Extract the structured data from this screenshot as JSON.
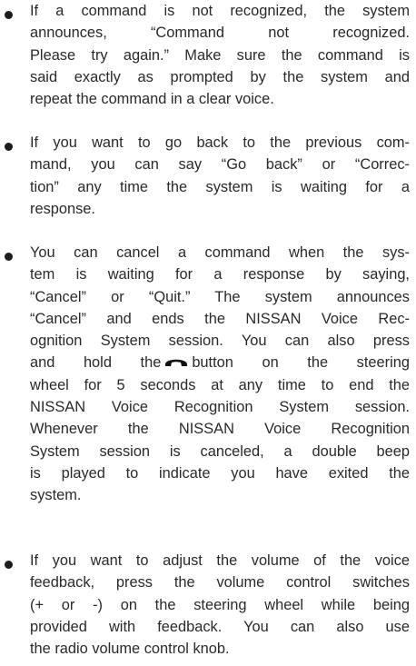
{
  "items": [
    {
      "lines": [
        "If a command is not recognized, the system",
        "announces, “Command not recognized.",
        "Please try again.” Make sure the command is",
        "said exactly as prompted by the system and",
        "repeat the command in a clear voice."
      ]
    },
    {
      "lines": [
        "If you want to go back to the previous com-",
        "mand, you can say “Go back” or “Correc-",
        "tion” any time the system is waiting for a",
        "response."
      ]
    },
    {
      "lines": [
        "You can cancel a command when the sys-",
        "tem is waiting for a response by saying,",
        "“Cancel” or “Quit.” The system announces",
        "“Cancel” and ends the NISSAN Voice Rec-",
        "ognition System session. You can also press"
      ],
      "icon_line_before": "and hold the",
      "icon": "phone-hang-up-icon",
      "icon_line_after": "button on the steering",
      "lines_after": [
        "wheel for 5 seconds at any time to end the",
        "NISSAN Voice Recognition System session.",
        "Whenever the NISSAN Voice Recognition",
        "System session is canceled, a double beep",
        "is played to indicate you have exited the",
        "system."
      ]
    },
    {
      "lines": [
        "If you want to adjust the volume of the voice",
        "feedback, press the volume control switches",
        "(+ or -) on the steering wheel while being",
        "provided with feedback. You can also use",
        "the radio volume control knob."
      ]
    }
  ]
}
